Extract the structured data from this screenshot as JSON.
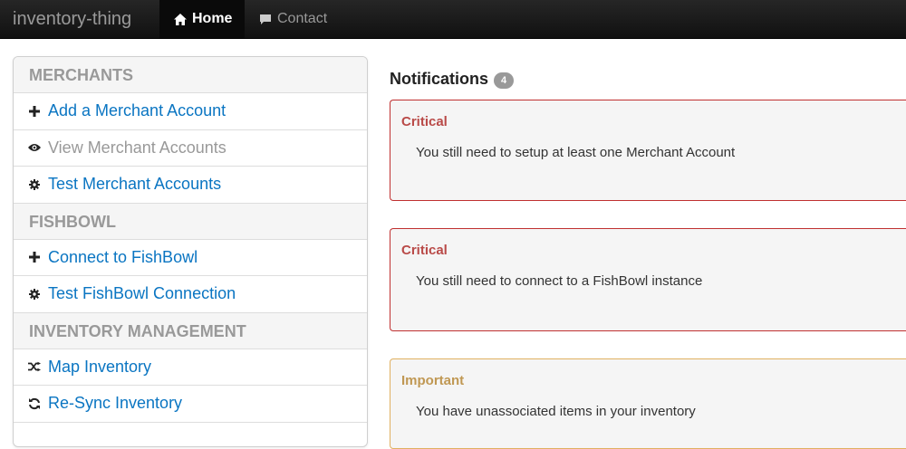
{
  "navbar": {
    "brand": "inventory-thing",
    "items": [
      {
        "label": "Home",
        "icon": "home-icon",
        "active": true
      },
      {
        "label": "Contact",
        "icon": "comment-icon",
        "active": false
      }
    ]
  },
  "sidebar": {
    "sections": [
      {
        "header": "MERCHANTS"
      },
      {
        "header": "FISHBOWL"
      },
      {
        "header": "INVENTORY MANAGEMENT"
      }
    ],
    "items": {
      "add_merchant": {
        "label": "Add a Merchant Account",
        "icon": "plus-icon"
      },
      "view_merchant": {
        "label": "View Merchant Accounts",
        "icon": "eye-icon"
      },
      "test_merchant": {
        "label": "Test Merchant Accounts",
        "icon": "cog-icon"
      },
      "connect_fishbowl": {
        "label": "Connect to FishBowl",
        "icon": "plus-icon"
      },
      "test_fishbowl": {
        "label": "Test FishBowl Connection",
        "icon": "cog-icon"
      },
      "map_inventory": {
        "label": "Map Inventory",
        "icon": "random-icon"
      },
      "resync_inventory": {
        "label": "Re-Sync Inventory",
        "icon": "refresh-icon"
      }
    }
  },
  "main": {
    "title": "Notifications",
    "count": "4",
    "alerts": [
      {
        "level": "Critical",
        "message": "You still need to setup at least one Merchant Account"
      },
      {
        "level": "Critical",
        "message": "You still need to connect to a FishBowl instance"
      },
      {
        "level": "Important",
        "message": "You have unassociated items in your inventory"
      }
    ]
  },
  "colors": {
    "link": "#0a75c2",
    "critical": "#b94a48",
    "important": "#c09853",
    "navbar": "#1b1b1b"
  }
}
